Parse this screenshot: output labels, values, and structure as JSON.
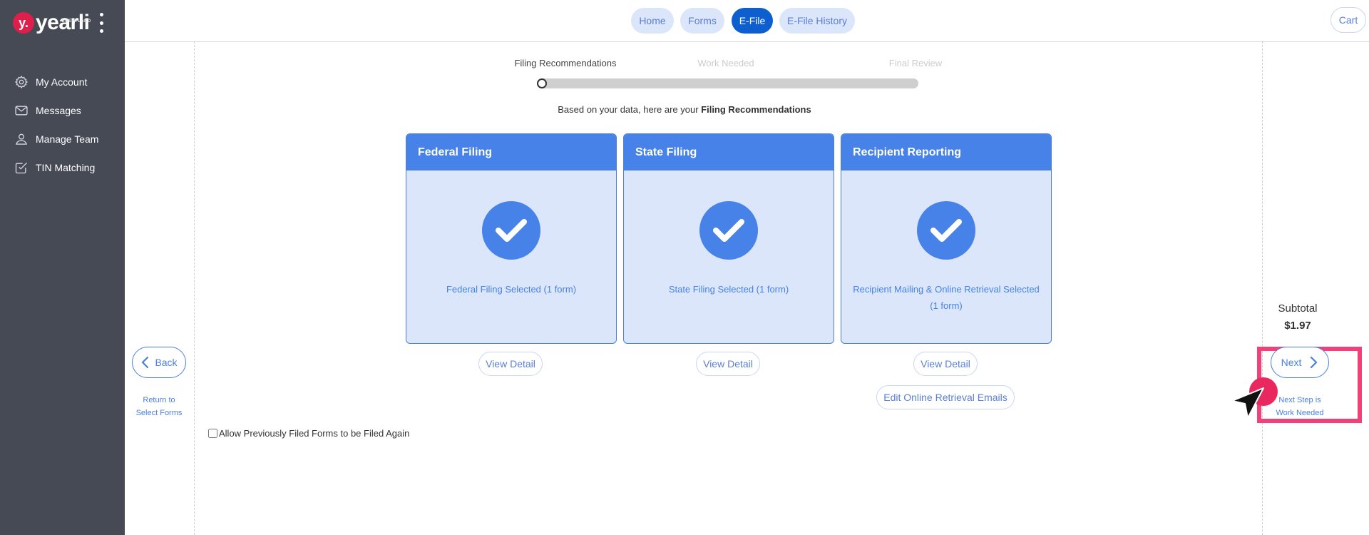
{
  "brand": {
    "mark": "y.",
    "name": "yearli",
    "small": "GREATLAND"
  },
  "sidebar": {
    "items": [
      {
        "label": "My Account",
        "icon": "gear-icon"
      },
      {
        "label": "Messages",
        "icon": "envelope-icon"
      },
      {
        "label": "Manage Team",
        "icon": "user-icon"
      },
      {
        "label": "TIN Matching",
        "icon": "check-square-icon"
      }
    ]
  },
  "nav": {
    "tabs": [
      {
        "label": "Home",
        "active": false
      },
      {
        "label": "Forms",
        "active": false
      },
      {
        "label": "E-File",
        "active": true
      },
      {
        "label": "E-File History",
        "active": false
      }
    ],
    "cart_label": "Cart"
  },
  "stepper": {
    "steps": [
      {
        "label": "Filing Recommendations",
        "current": true
      },
      {
        "label": "Work Needed",
        "current": false
      },
      {
        "label": "Final Review",
        "current": false
      }
    ],
    "progress_fraction": 0
  },
  "intro": {
    "prefix": "Based on your data, here are your ",
    "emphasis": "Filing Recommendations"
  },
  "cards": [
    {
      "title": "Federal Filing",
      "status": "Federal Filing Selected (1 form)",
      "detail_label": "View Detail"
    },
    {
      "title": "State Filing",
      "status": "State Filing Selected (1 form)",
      "detail_label": "View Detail"
    },
    {
      "title": "Recipient Reporting",
      "status": "Recipient Mailing & Online Retrieval Selected (1 form)",
      "detail_label": "View Detail",
      "extra_label": "Edit Online Retrieval Emails"
    }
  ],
  "back": {
    "label": "Back",
    "hint_line1": "Return to",
    "hint_line2": "Select Forms"
  },
  "next": {
    "label": "Next",
    "hint_line1": "Next Step is",
    "hint_line2": "Work Needed"
  },
  "subtotal": {
    "label": "Subtotal",
    "value": "$1.97"
  },
  "refile_checkbox": {
    "label": "Allow Previously Filed Forms to be Filed Again",
    "checked": false
  },
  "colors": {
    "accent": "#4682e8",
    "active_tab": "#0d5fd0",
    "sidebar": "#454a55",
    "highlight": "#f0417a"
  }
}
